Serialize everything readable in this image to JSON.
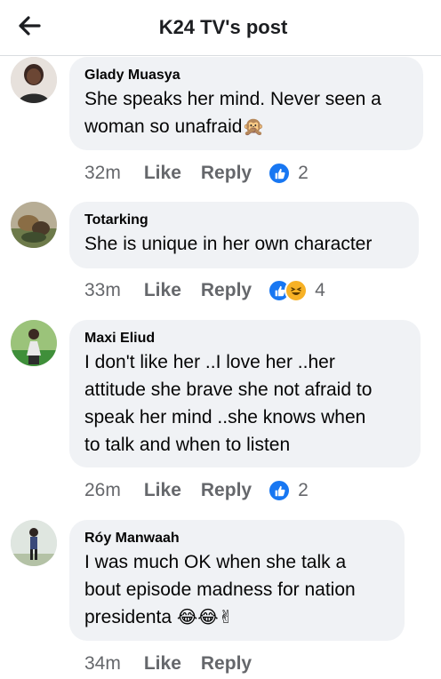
{
  "header": {
    "title": "K24 TV's post",
    "back_icon": "arrow-left-icon"
  },
  "colors": {
    "accent": "#1877f2",
    "bubble": "#f0f2f5",
    "meta_text": "#65676b",
    "haha": "#f7b125"
  },
  "comments": [
    {
      "author": "Glady Muasya",
      "text": "She speaks her mind. Never seen a woman so unafraid🙊",
      "lines": [
        "She speaks her mind. Never seen a",
        "woman so unafraid"
      ],
      "emoji": "🙊",
      "time": "32m",
      "like_label": "Like",
      "reply_label": "Reply",
      "reactions": [
        "like"
      ],
      "reaction_count": "2"
    },
    {
      "author": "Totarking",
      "text": "She is unique in her own character",
      "lines": [
        "She is unique in her own character"
      ],
      "time": "33m",
      "like_label": "Like",
      "reply_label": "Reply",
      "reactions": [
        "like",
        "haha"
      ],
      "reaction_count": "4"
    },
    {
      "author": "Maxi Eliud",
      "text": "I don't like her ..I love her ..her attitude she brave she not afraid to speak her mind ..she knows when to talk and when to listen",
      "lines": [
        "I don't like her ..I love her ..her",
        "attitude she brave she not afraid to",
        "speak her mind ..she knows when",
        "to talk and when to listen"
      ],
      "time": "26m",
      "like_label": "Like",
      "reply_label": "Reply",
      "reactions": [
        "like"
      ],
      "reaction_count": "2"
    },
    {
      "author": "Róy Manwaah",
      "text": "I was much OK when she talk a bout episode madness for nation presidenta 😂😂✌",
      "lines": [
        "I was much OK when she talk a",
        "bout episode madness for nation",
        "presidenta "
      ],
      "emoji": "😂😂✌",
      "time": "34m",
      "like_label": "Like",
      "reply_label": "Reply"
    }
  ]
}
